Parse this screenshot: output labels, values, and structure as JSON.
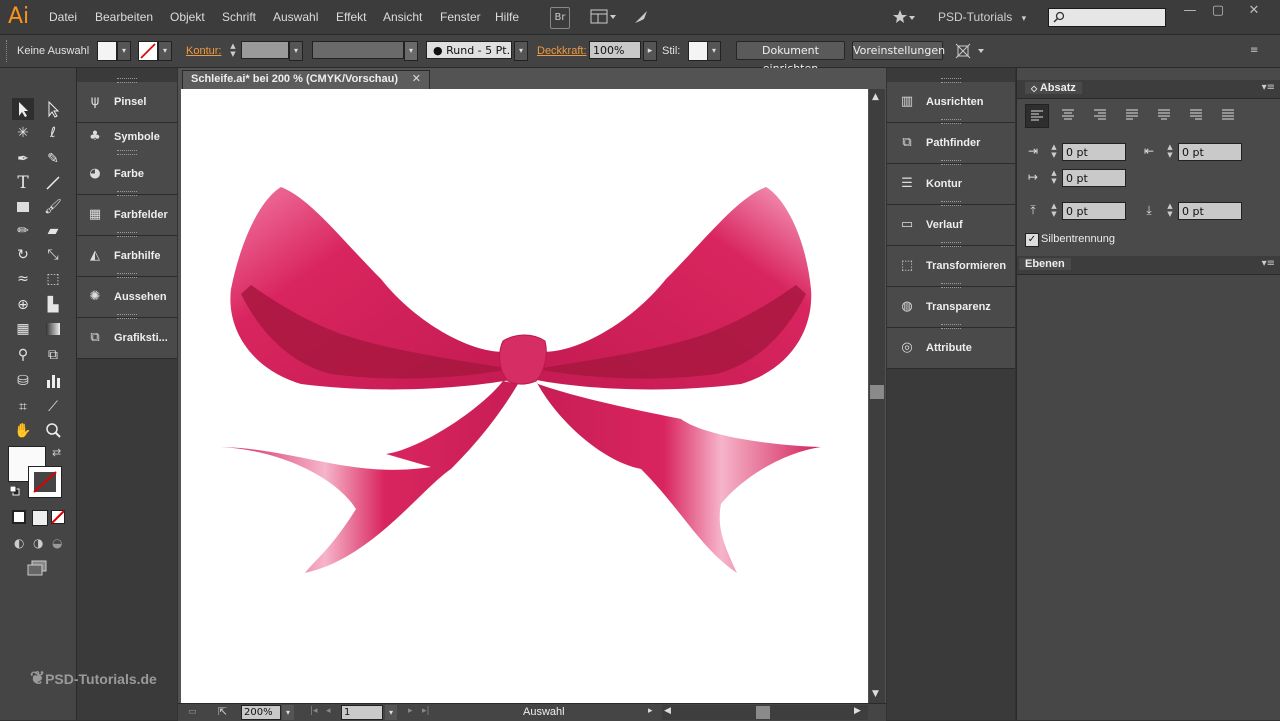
{
  "app": {
    "logo": "Ai"
  },
  "menu": [
    "Datei",
    "Bearbeiten",
    "Objekt",
    "Schrift",
    "Auswahl",
    "Effekt",
    "Ansicht",
    "Fenster",
    "Hilfe"
  ],
  "menubar_icons": {
    "bridge": "Br"
  },
  "workspace": {
    "label": "PSD-Tutorials"
  },
  "window_controls": {
    "minimize": "—",
    "restore": "▢",
    "close": "✕"
  },
  "control_bar": {
    "selection": "Keine Auswahl",
    "kontur_label": "Kontur:",
    "brush_label": "Rund - 5 Pt.",
    "opacity_label": "Deckkraft:",
    "opacity_value": "100%",
    "style_label": "Stil:",
    "doc_setup_button": "Dokument einrichten",
    "preferences_button": "Voreinstellungen"
  },
  "document": {
    "tab_title": "Schleife.ai* bei 200 % (CMYK/Vorschau)",
    "zoom": "200%",
    "artboard": "1",
    "status": "Auswahl"
  },
  "left_dock": [
    {
      "label": "Pinsel",
      "icon": "brush-icon"
    },
    {
      "label": "Symbole",
      "icon": "club-icon"
    },
    {
      "label": "Farbe",
      "icon": "palette-icon"
    },
    {
      "label": "Farbfelder",
      "icon": "grid-icon"
    },
    {
      "label": "Farbhilfe",
      "icon": "color-guide-icon"
    },
    {
      "label": "Aussehen",
      "icon": "sun-icon"
    },
    {
      "label": "Grafiksti...",
      "icon": "graphic-style-icon"
    }
  ],
  "right_dock": [
    {
      "label": "Ausrichten",
      "icon": "align-icon"
    },
    {
      "label": "Pathfinder",
      "icon": "pathfinder-icon"
    },
    {
      "label": "Kontur",
      "icon": "stroke-icon"
    },
    {
      "label": "Verlauf",
      "icon": "gradient-icon"
    },
    {
      "label": "Transformieren",
      "icon": "transform-icon"
    },
    {
      "label": "Transparenz",
      "icon": "transparency-icon"
    },
    {
      "label": "Attribute",
      "icon": "attributes-icon"
    }
  ],
  "paragraph_panel": {
    "title": "Absatz",
    "left_indent": "0 pt",
    "right_indent": "0 pt",
    "first_line_indent": "0 pt",
    "space_before": "0 pt",
    "space_after": "0 pt",
    "hyphenation_label": "Silbentrennung",
    "hyphenation_checked": true
  },
  "layers_panel": {
    "title": "Ebenen"
  },
  "watermark": "PSD-Tutorials.de",
  "colors": {
    "ribbon": "#d9255f",
    "ribbon_dark": "#a8173f",
    "ribbon_light": "#f08ab0",
    "accent": "#f7931e"
  }
}
